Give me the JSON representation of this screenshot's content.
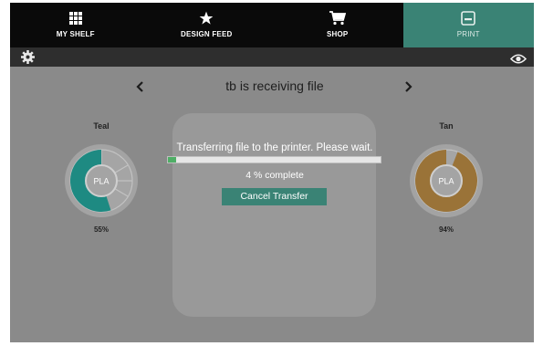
{
  "nav": {
    "items": [
      {
        "label": "MY SHELF",
        "icon": "grid-icon"
      },
      {
        "label": "DESIGN FEED",
        "icon": "star-icon"
      },
      {
        "label": "SHOP",
        "icon": "cart-icon"
      },
      {
        "label": "PRINT",
        "icon": "printer-icon"
      }
    ],
    "active": "PRINT",
    "active_color": "#3a8375"
  },
  "toolbar": {
    "left_icon": "gear-icon",
    "right_icon": "eye-icon"
  },
  "header": {
    "title": "tb is receiving file",
    "prev_icon": "chevron-left-icon",
    "next_icon": "chevron-right-icon"
  },
  "spools": [
    {
      "name": "Teal",
      "material": "PLA",
      "percent_label": "55%",
      "fill_fraction": 0.55,
      "color": "#1e8a82"
    },
    {
      "name": "Tan",
      "material": "PLA",
      "percent_label": "94%",
      "fill_fraction": 0.94,
      "color": "#9a7338"
    }
  ],
  "modal": {
    "message": "Transferring file to the printer. Please wait.",
    "progress_percent": 4,
    "progress_text": "4 % complete",
    "cancel_label": "Cancel Transfer",
    "progress_color": "#4fae66"
  }
}
